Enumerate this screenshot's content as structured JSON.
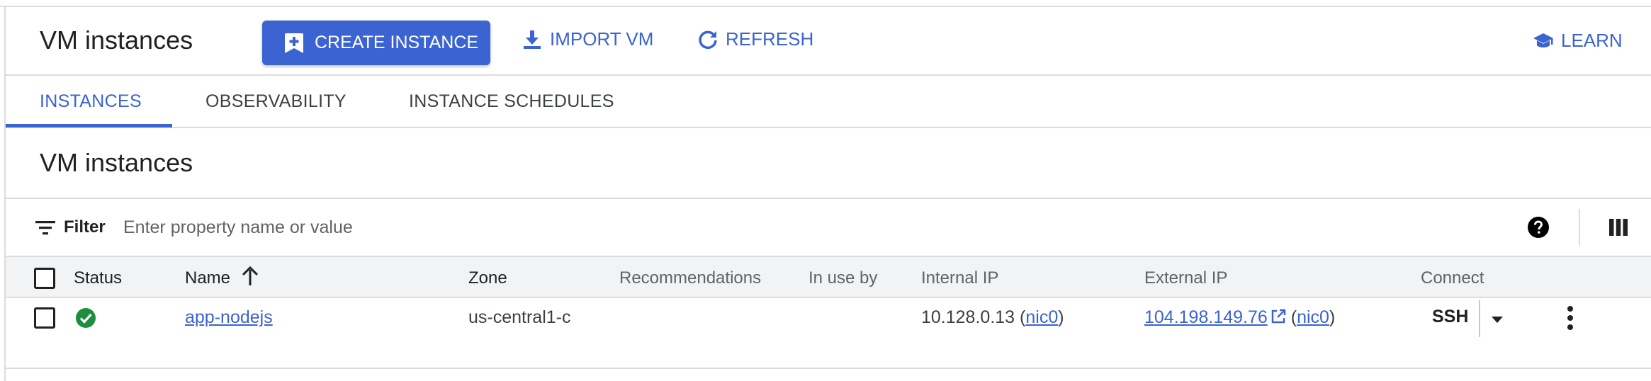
{
  "header": {
    "title": "VM instances",
    "create_label": "CREATE INSTANCE",
    "import_label": "IMPORT VM",
    "refresh_label": "REFRESH",
    "learn_label": "LEARN"
  },
  "tabs": [
    {
      "label": "INSTANCES",
      "active": true
    },
    {
      "label": "OBSERVABILITY",
      "active": false
    },
    {
      "label": "INSTANCE SCHEDULES",
      "active": false
    }
  ],
  "section": {
    "title": "VM instances"
  },
  "filter": {
    "label": "Filter",
    "placeholder": "Enter property name or value",
    "value": ""
  },
  "table": {
    "columns": [
      "Status",
      "Name",
      "Zone",
      "Recommendations",
      "In use by",
      "Internal IP",
      "External IP",
      "Connect"
    ],
    "sort": {
      "column": "Name",
      "direction": "ascending"
    },
    "rows": [
      {
        "status": "running",
        "name": "app-nodejs",
        "zone": "us-central1-c",
        "recommendations": "",
        "in_use_by": "",
        "internal_ip": "10.128.0.13",
        "internal_nic": "nic0",
        "external_ip": "104.198.149.76",
        "external_nic": "nic0",
        "connect": "SSH"
      }
    ]
  },
  "colors": {
    "accent": "#3b63d1",
    "status_ok": "#1e8e3e",
    "header_bg": "#f1f3f4",
    "border": "#dadce0"
  },
  "icons": {
    "create": "add-box-icon",
    "import": "download-icon",
    "refresh": "refresh-icon",
    "learn": "school-icon",
    "filter": "filter-list-icon",
    "help": "help-icon",
    "columns": "view-column-icon",
    "sort": "arrow-upward-icon",
    "status": "check-circle-icon",
    "external": "open-in-new-icon",
    "ssh_menu": "arrow-drop-down-icon",
    "more": "more-vert-icon"
  }
}
